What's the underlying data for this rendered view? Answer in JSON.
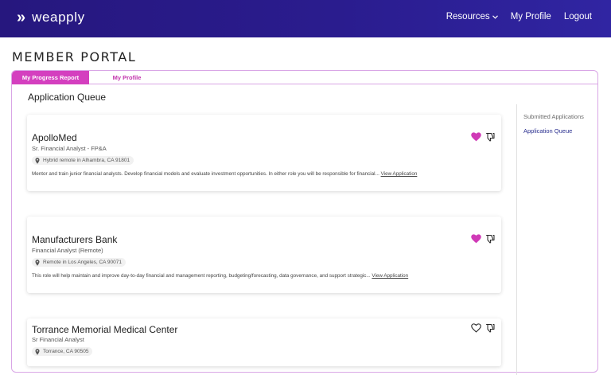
{
  "nav": {
    "logo_text": "weapply",
    "links": [
      {
        "label": "Resources",
        "has_caret": true
      },
      {
        "label": "My Profile"
      },
      {
        "label": "Logout"
      }
    ]
  },
  "page": {
    "title": "MEMBER PORTAL"
  },
  "tabs": [
    {
      "label": "My Progress Report",
      "active": true
    },
    {
      "label": "My Profile",
      "active": false
    }
  ],
  "main": {
    "section_title": "Application Queue"
  },
  "sidebar": {
    "items": [
      {
        "label": "Submitted Applications",
        "active": false
      },
      {
        "label": "Application Queue",
        "active": true
      }
    ]
  },
  "jobs": [
    {
      "company": "ApolloMed",
      "role": "Sr. Financial Analyst - FP&A",
      "location": "Hybrid remote in Alhambra, CA 91801",
      "description": "Mentor and train junior financial analysts. Develop financial models and evaluate investment opportunities. In either role you will be responsible for financial...",
      "link_label": "View Application",
      "liked": true
    },
    {
      "company": "Manufacturers Bank",
      "role": "Financial Analyst (Remote)",
      "location": "Remote in Los Angeles, CA 90071",
      "description": "This role will help maintain and improve day-to-day financial and management reporting, budgeting/forecasting, data governance, and support strategic...",
      "link_label": "View Application",
      "liked": true
    },
    {
      "company": "Torrance Memorial Medical Center",
      "role": "Sr Financial Analyst",
      "location": "Torrance, CA 90505",
      "description": "",
      "link_label": "",
      "liked": false
    }
  ],
  "colors": {
    "nav_bg": "#2a1c8e",
    "accent": "#d43fbf",
    "heart_filled": "#d03ab7",
    "sidebar_active": "#2a2f8f"
  }
}
